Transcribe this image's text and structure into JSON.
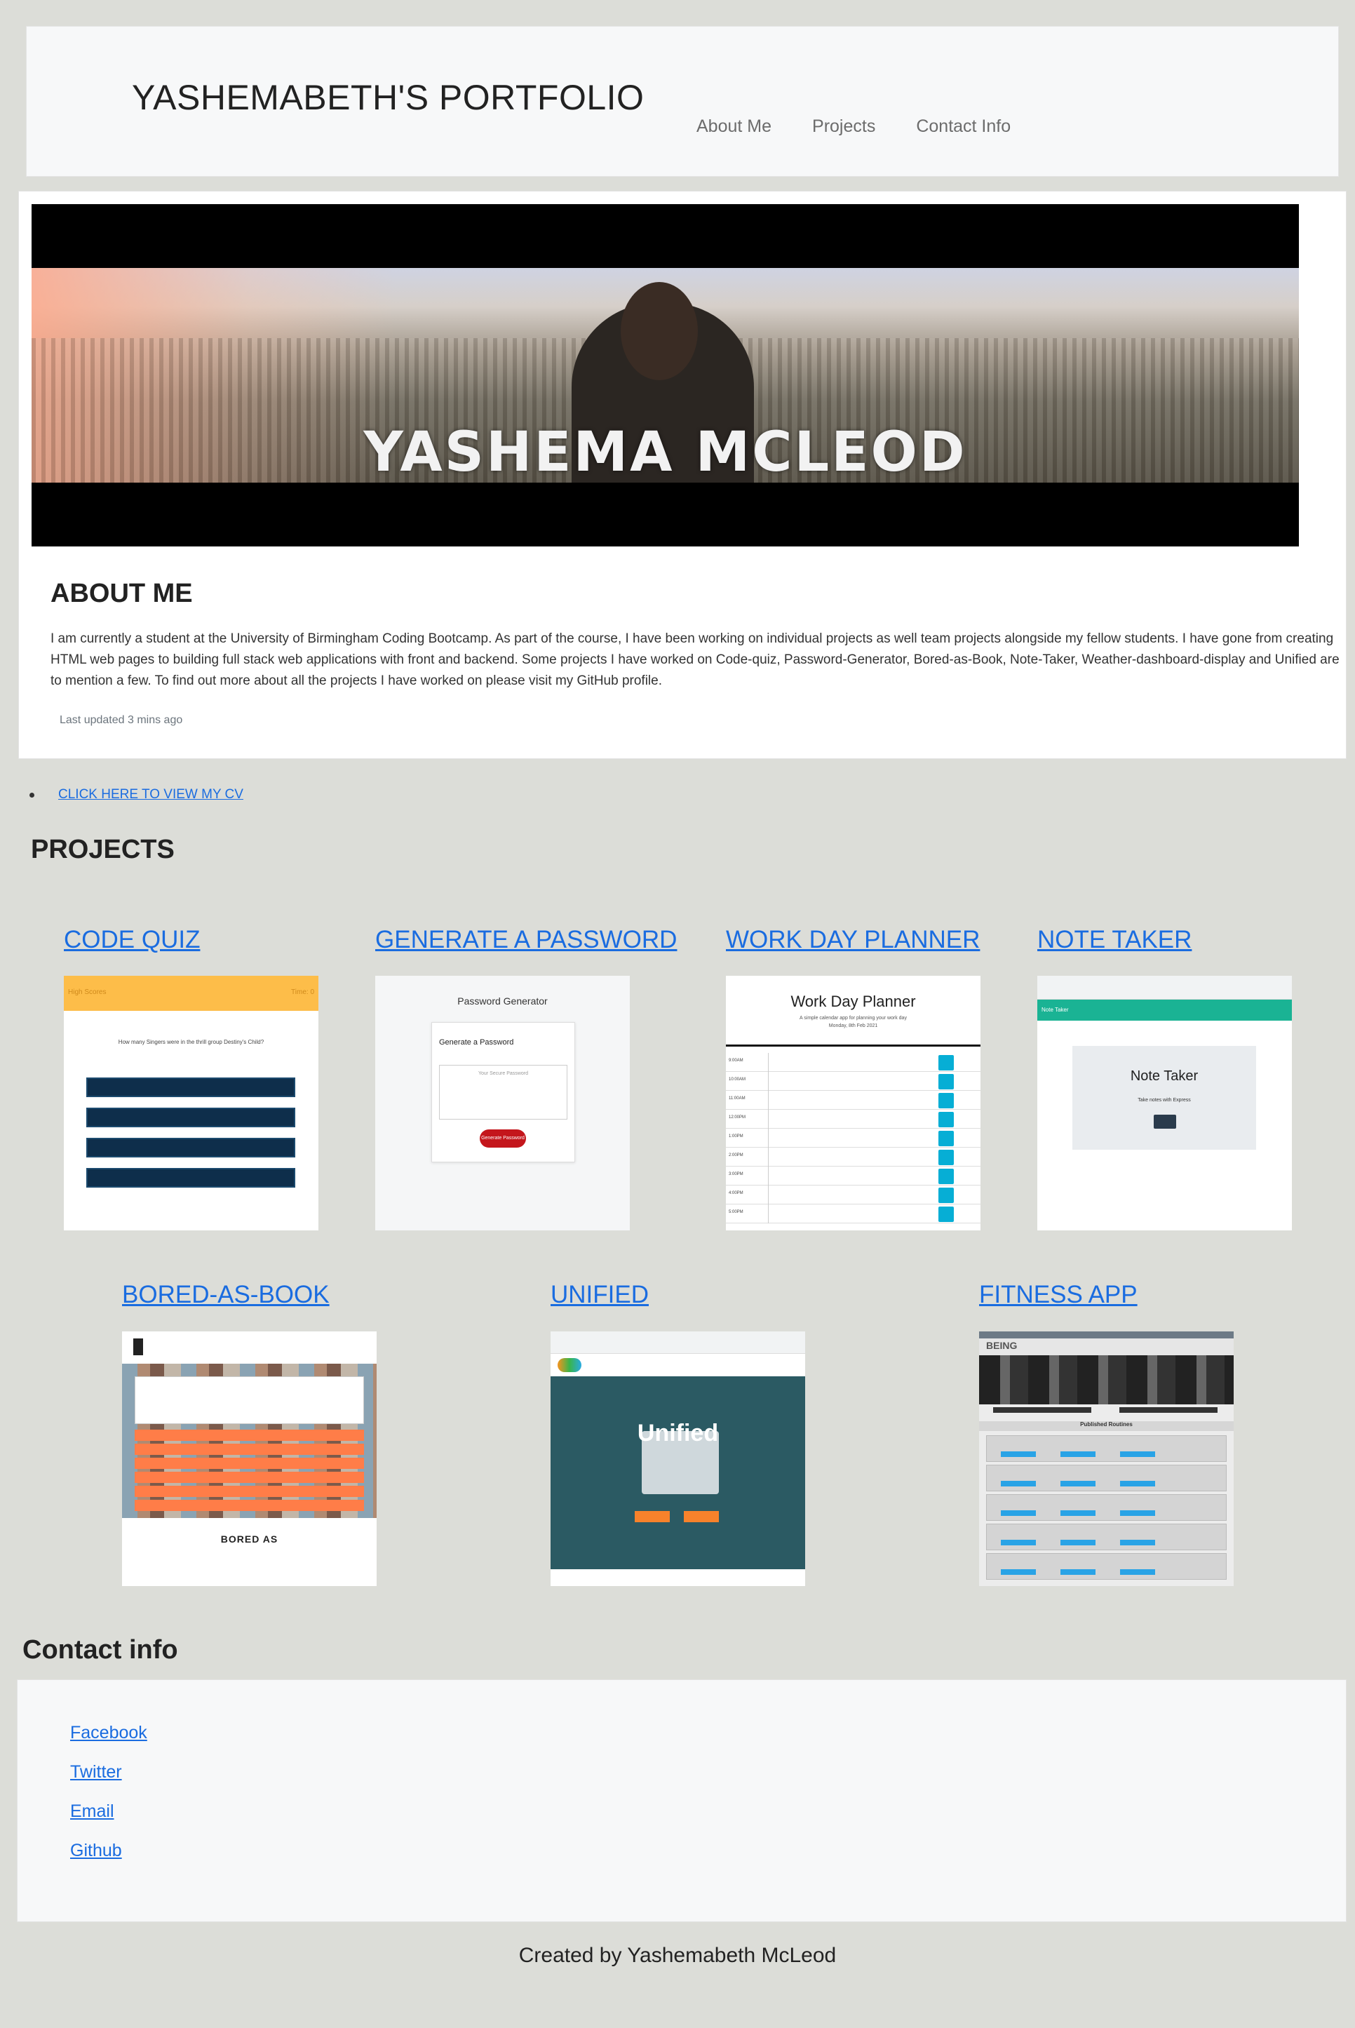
{
  "nav": {
    "brand": "YASHEMABETH'S PORTFOLIO",
    "links": [
      "About Me",
      "Projects",
      "Contact Info"
    ]
  },
  "hero": {
    "banner_text": "YASHEMA MCLEOD"
  },
  "about": {
    "title": "ABOUT ME",
    "text": "I am currently a student at the University of Birmingham Coding Bootcamp. As part of the course, I have been working on individual projects as well team projects alongside my fellow students. I have gone from creating HTML web pages to building full stack web applications with front and backend. Some projects I have worked on Code-quiz, Password-Generator, Bored-as-Book, Note-Taker, Weather-dashboard-display and Unified are to mention a few. To find out more about all the projects I have worked on please visit my GitHub profile.",
    "updated": "Last updated 3 mins ago"
  },
  "cv": {
    "label": "CLICK HERE TO VIEW MY CV"
  },
  "projects": {
    "title": "PROJECTS",
    "items": [
      {
        "title": "CODE QUIZ"
      },
      {
        "title": "GENERATE A PASSWORD"
      },
      {
        "title": "WORK DAY PLANNER"
      },
      {
        "title": "NOTE TAKER"
      },
      {
        "title": "BORED-AS-BOOK"
      },
      {
        "title": "UNIFIED"
      },
      {
        "title": "FITNESS APP"
      }
    ]
  },
  "thumbs": {
    "password_title": "Password Generator",
    "password_heading": "Generate a Password",
    "password_placeholder": "Your Secure Password",
    "password_button": "Generate Password",
    "planner_title": "Work Day Planner",
    "planner_sub": "A simple calendar app for planning your work day",
    "planner_date": "Monday, 8th Feb 2021",
    "note_title": "Note Taker",
    "note_sub": "Take notes with Express",
    "bored_title": "BORED AS",
    "unified_word": "Unified",
    "fitness_brand": "BEING",
    "fitness_pub": "Published Routines"
  },
  "contact": {
    "title": "Contact info",
    "links": [
      "Facebook",
      "Twitter",
      "Email",
      "Github"
    ]
  },
  "footer": {
    "text": "Created by Yashemabeth McLeod"
  },
  "colors": {
    "link": "#1a6ce0",
    "page_bg": "#dcddd8",
    "card_bg": "#f7f8f9"
  }
}
